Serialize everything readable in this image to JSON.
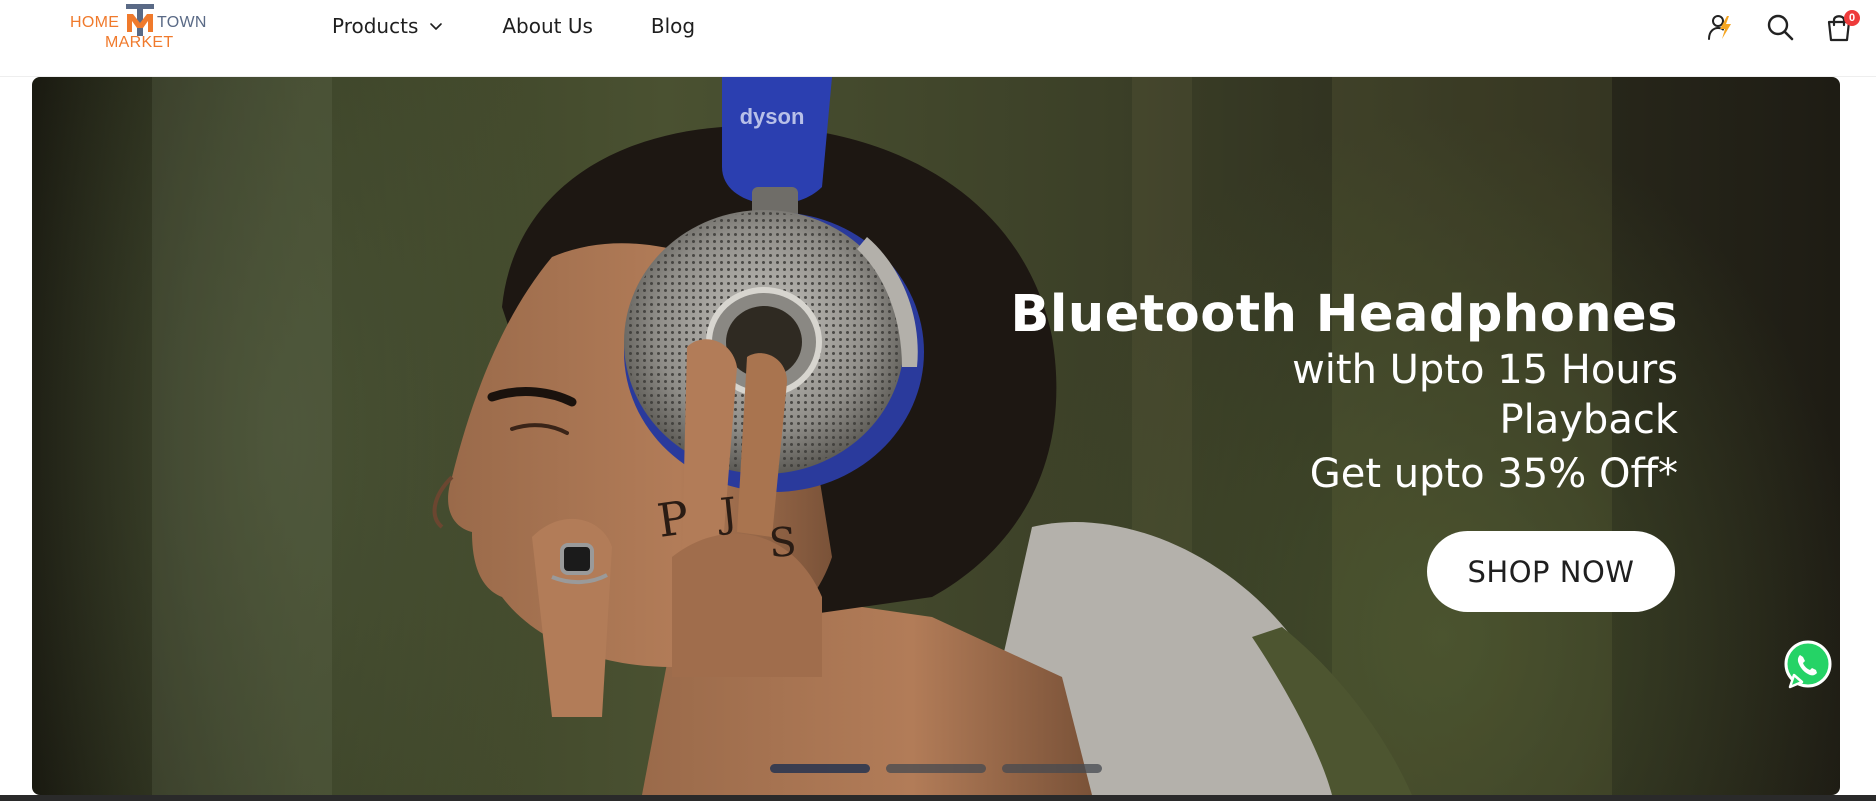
{
  "brand": {
    "logo_home": "HOME",
    "logo_town": "TOWN",
    "logo_market": "MARKET"
  },
  "nav": {
    "items": [
      {
        "label": "Products",
        "has_dropdown": true
      },
      {
        "label": "About Us"
      },
      {
        "label": "Blog"
      }
    ]
  },
  "header_actions": {
    "icons": [
      "user-lightning-icon",
      "search-icon",
      "cart-icon"
    ],
    "cart_count": "0"
  },
  "hero": {
    "headline": "Bluetooth Headphones",
    "subline_1": "with Upto 15 Hours",
    "subline_2": "Playback",
    "offer": "Get upto 35% Off*",
    "cta_label": "SHOP NOW",
    "product_brand": "dyson",
    "slides_total": 3,
    "active_slide": 1
  },
  "colors": {
    "logo_orange": "#f07a2c",
    "logo_slate": "#5a6a86",
    "cart_badge": "#ee3b3b",
    "whatsapp": "#25d366"
  }
}
